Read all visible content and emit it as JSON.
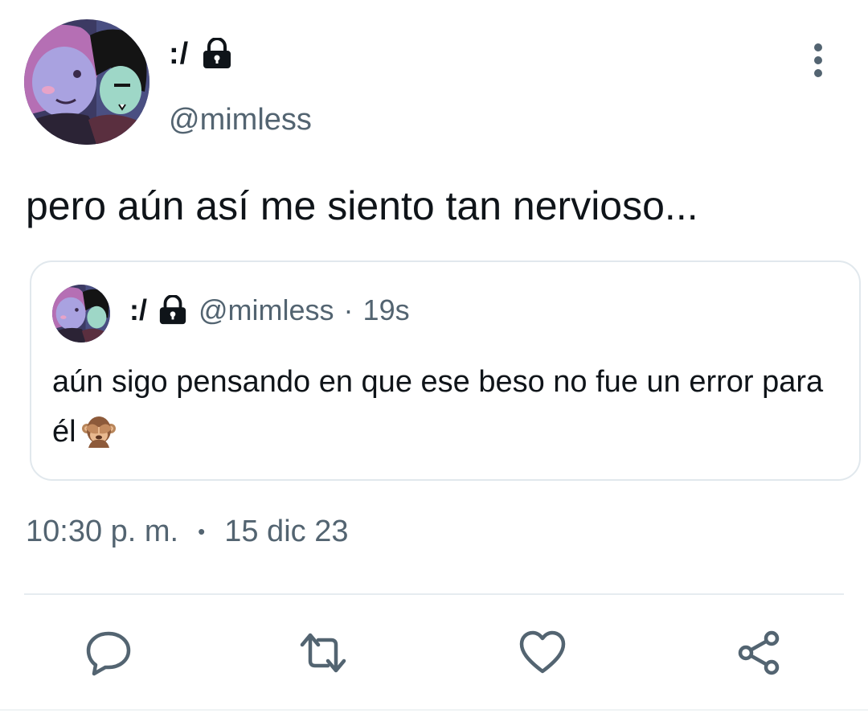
{
  "author": {
    "display_name": ":/",
    "handle": "@mimless",
    "protected_icon": "lock-icon"
  },
  "tweet": {
    "text": "pero aún así me siento tan nervioso..."
  },
  "quoted_tweet": {
    "display_name": ":/",
    "handle": "@mimless",
    "separator": "·",
    "time": "19s",
    "text": "aún sigo pensando en que ese beso no fue un error para él",
    "emoji": "see-no-evil-monkey"
  },
  "meta": {
    "time": "10:30 p. m.",
    "separator": "•",
    "date": "15 dic 23"
  },
  "actions": {
    "reply_icon": "reply-icon",
    "retweet_icon": "retweet-icon",
    "like_icon": "heart-icon",
    "share_icon": "share-icon"
  },
  "colors": {
    "text_primary": "#0f1419",
    "text_secondary": "#536471",
    "border": "#e1e8ed"
  }
}
